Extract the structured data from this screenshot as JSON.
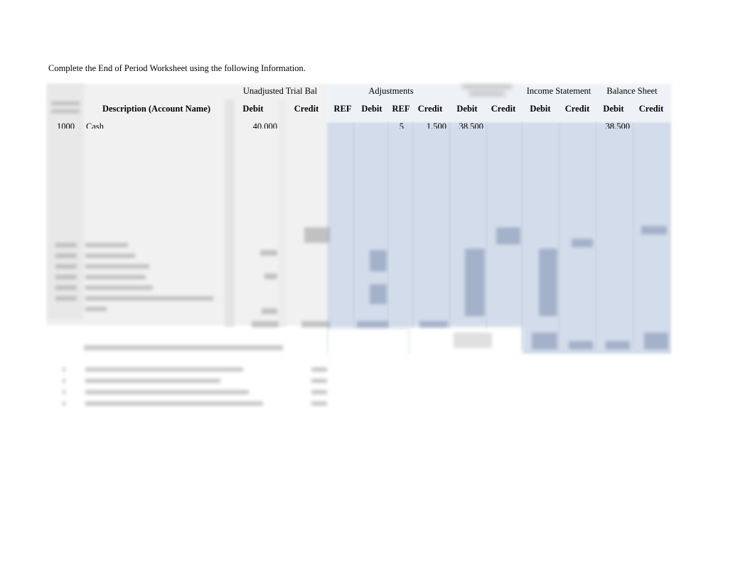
{
  "instruction": "Complete the End of Period Worksheet using the following Information.",
  "worksheet": {
    "group_headers": {
      "unadjusted_trial_balance": "Unadjusted Trial Bal",
      "adjustments": "Adjustments",
      "income_statement": "Income Statement",
      "balance_sheet": "Balance Sheet"
    },
    "column_headers": {
      "description": "Description  (Account Name)",
      "utb_debit": "Debit",
      "utb_credit": "Credit",
      "adj_ref_debit": "REF",
      "adj_debit": "Debit",
      "adj_ref_credit": "REF",
      "adj_credit": "Credit",
      "atb_debit": "Debit",
      "atb_credit": "Credit",
      "is_debit": "Debit",
      "is_credit": "Credit",
      "bs_debit": "Debit",
      "bs_credit": "Credit"
    },
    "rows": [
      {
        "account_no": "1000",
        "description": "Cash",
        "utb_debit": "40,000",
        "adj_ref_credit": "5",
        "adj_credit": "1,500",
        "atb_debit": "38,500",
        "bs_debit": "38,500"
      }
    ],
    "blurred_notice": "Remaining worksheet rows, totals and adjustment notes are blurred"
  },
  "colors": {
    "gray_panel": "#f1f1f1",
    "blue_panel": "#d3dcea"
  }
}
